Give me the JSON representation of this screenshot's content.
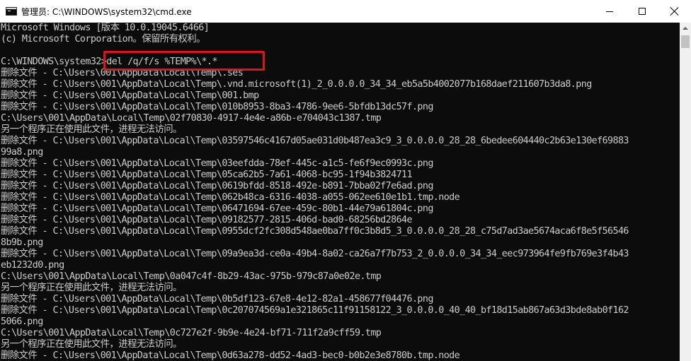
{
  "window": {
    "title": "管理员: C:\\WINDOWS\\system32\\cmd.exe",
    "icon": "cmd-icon",
    "controls": {
      "minimize": "minimize-icon",
      "maximize": "maximize-icon",
      "close": "close-icon"
    }
  },
  "colors": {
    "console_background": "#0c0c0c",
    "console_text": "#cccccc",
    "highlight_box": "#e3131b",
    "titlebar": "#ffffff"
  },
  "console": {
    "lines": [
      "Microsoft Windows [版本 10.0.19045.6466]",
      "(c) Microsoft Corporation。保留所有权利。",
      "",
      "C:\\WINDOWS\\system32>del /q/f/s %TEMP%\\*.*",
      "删除文件 - C:\\Users\\001\\AppData\\Local\\Temp\\.ses",
      "删除文件 - C:\\Users\\001\\AppData\\Local\\Temp\\.vnd.microsoft(1)_2_0.0.0.0_34_34_eb5a5b4002077b168daef211607b3da8.png",
      "删除文件 - C:\\Users\\001\\AppData\\Local\\Temp\\001.bmp",
      "删除文件 - C:\\Users\\001\\AppData\\Local\\Temp\\010b8953-8ba3-4786-9ee6-5bfdb13dc57f.png",
      "C:\\Users\\001\\AppData\\Local\\Temp\\02f70830-4917-4e4e-a86b-e704043c1387.tmp",
      "另一个程序正在使用此文件，进程无法访问。",
      "删除文件 - C:\\Users\\001\\AppData\\Local\\Temp\\03597546c4167d05ae031d0b487ea3c9_3_0.0.0.0_28_28_6bedee604440c2b63e130ef69883",
      "99a8.png",
      "删除文件 - C:\\Users\\001\\AppData\\Local\\Temp\\03eefdda-78ef-445c-a1c5-fe6f9ec0993c.png",
      "删除文件 - C:\\Users\\001\\AppData\\Local\\Temp\\05ca62b5-7a61-4068-bc95-1f94b3824711",
      "删除文件 - C:\\Users\\001\\AppData\\Local\\Temp\\0619bfdd-8518-492e-b891-7bba02f7e6ad.png",
      "删除文件 - C:\\Users\\001\\AppData\\Local\\Temp\\062b48ca-6316-4038-a055-062ee610e1b1.tmp.node",
      "删除文件 - C:\\Users\\001\\AppData\\Local\\Temp\\06471694-67ee-459c-80b1-44e79a61804c.png",
      "删除文件 - C:\\Users\\001\\AppData\\Local\\Temp\\09182577-2815-406d-bad0-68256bd2864e",
      "删除文件 - C:\\Users\\001\\AppData\\Local\\Temp\\0955dcf2fc308d548ae0ba7ff0c3b8d5_3_0.0.0.0_28_28_c75d7ad3ae5674aca6f8e5f56546",
      "8b9b.png",
      "删除文件 - C:\\Users\\001\\AppData\\Local\\Temp\\09a9ea3d-ce0a-49b4-8a02-ca26a7f7b753_2_0.0.0.0_34_34_eec973964fe9fb769e3f4b43",
      "eb1232d0.png",
      "C:\\Users\\001\\AppData\\Local\\Temp\\0a047c4f-8b29-43ac-975b-979c87a0e02e.tmp",
      "另一个程序正在使用此文件，进程无法访问。",
      "删除文件 - C:\\Users\\001\\AppData\\Local\\Temp\\0b5df123-67e8-4e12-82a1-458677f04476.png",
      "删除文件 - C:\\Users\\001\\AppData\\Local\\Temp\\0c207074569a1e321865c11f91158122_3_0.0.0.0_40_40_bf18d15ab867a63d3bde8ab0f162",
      "5066.png",
      "C:\\Users\\001\\AppData\\Local\\Temp\\0c727e2f-9b9e-4e24-bf71-711f2a9cff59.tmp",
      "另一个程序正在使用此文件，进程无法访问。",
      "删除文件 - C:\\Users\\001\\AppData\\Local\\Temp\\0d63a278-dd52-4ad3-bec0-b0b2e3e8780b.tmp.node"
    ]
  },
  "annotation": {
    "highlighted_command": "del /q/f/s %TEMP%\\*.*"
  }
}
